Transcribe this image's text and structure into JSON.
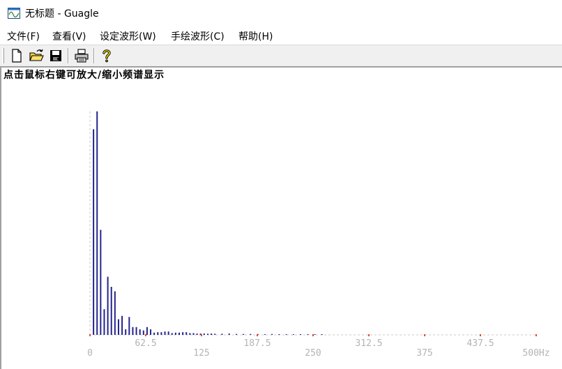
{
  "window": {
    "title": "无标题 - Guagle"
  },
  "menu": {
    "items": [
      {
        "label": "文件(F)"
      },
      {
        "label": "查看(V)"
      },
      {
        "label": "设定波形(W)"
      },
      {
        "label": "手绘波形(C)"
      },
      {
        "label": "帮助(H)"
      }
    ]
  },
  "toolbar": {
    "buttons": [
      {
        "icon": "new-file-icon"
      },
      {
        "icon": "open-folder-icon"
      },
      {
        "icon": "save-disk-icon"
      },
      {
        "icon": "printer-icon"
      },
      {
        "icon": "help-question-icon"
      }
    ]
  },
  "view": {
    "hint": "点击鼠标右键可放大/缩小频谱显示"
  },
  "chart_data": {
    "type": "bar",
    "x_tick_labels": [
      "0",
      "62.5",
      "125",
      "187.5",
      "250",
      "312.5",
      "375",
      "437.5",
      "500Hz"
    ],
    "xlim": [
      0,
      500
    ],
    "ylim": [
      0,
      1.0
    ],
    "x": [
      4,
      8,
      12,
      16,
      20,
      24,
      28,
      32,
      36,
      40,
      44,
      48,
      52,
      56,
      60,
      64,
      68,
      72,
      76,
      80,
      84,
      88,
      92,
      96,
      100,
      104,
      108,
      112,
      116,
      120,
      124,
      128,
      132,
      136,
      140,
      148,
      156,
      164,
      172,
      180,
      188,
      196,
      204,
      212,
      220,
      228,
      236,
      244,
      252,
      260
    ],
    "values": [
      0.92,
      1.0,
      0.47,
      0.115,
      0.26,
      0.215,
      0.195,
      0.07,
      0.085,
      0.025,
      0.08,
      0.035,
      0.035,
      0.025,
      0.02,
      0.035,
      0.025,
      0.01,
      0.012,
      0.012,
      0.015,
      0.015,
      0.008,
      0.01,
      0.01,
      0.012,
      0.012,
      0.008,
      0.008,
      0.006,
      0.006,
      0.006,
      0.005,
      0.006,
      0.005,
      0.005,
      0.006,
      0.004,
      0.004,
      0.004,
      0.004,
      0.003,
      0.004,
      0.003,
      0.003,
      0.003,
      0.003,
      0.003,
      0.003,
      0.003
    ],
    "colors": {
      "bars": "#23238c",
      "axis": "#c8c8c8",
      "tick": "#e05030",
      "tick_labels": "#b4b4b4"
    },
    "grid": false
  }
}
